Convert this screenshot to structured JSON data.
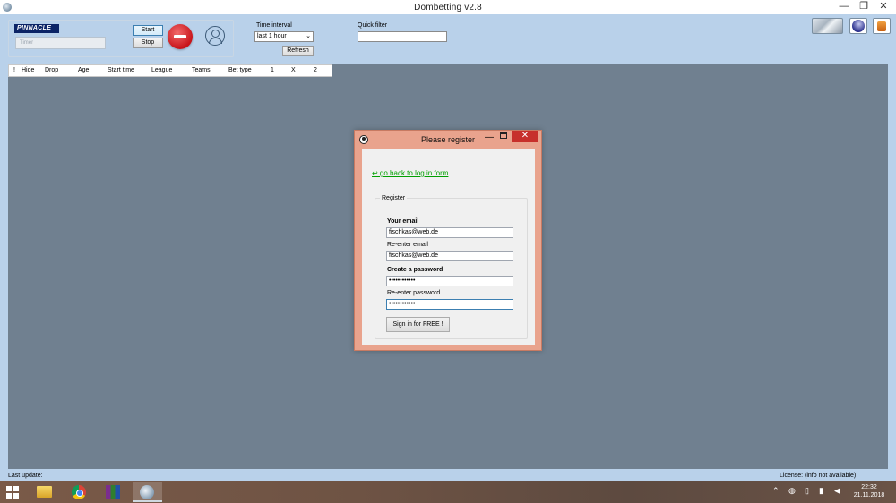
{
  "window": {
    "title": "Dombetting   v2.8",
    "min": "—",
    "max": "❐",
    "close": "✕"
  },
  "toolbar": {
    "logo": "PINNACLE",
    "timer_placeholder": "Timer",
    "start": "Start",
    "stop": "Stop",
    "time_interval_label": "Time interval",
    "time_interval_value": "last 1 hour",
    "refresh": "Refresh",
    "quick_filter_label": "Quick filter",
    "quick_filter_value": ""
  },
  "grid": {
    "columns": [
      "!",
      "Hide",
      "Drop",
      "Age",
      "Start time",
      "League",
      "Teams",
      "Bet type",
      "1",
      "X",
      "2"
    ]
  },
  "dialog": {
    "title": "Please register",
    "back_link": "↩ go back to log in form",
    "group": "Register",
    "email_label": "Your email",
    "email_value": "fischkas@web.de",
    "reemail_label": "Re-enter email",
    "reemail_value": "fischkas@web.de",
    "password_label": "Create a password",
    "password_value": "••••••••••••",
    "repassword_label": "Re-enter password",
    "repassword_value": "••••••••••••",
    "signin": "Sign in for FREE !"
  },
  "status": {
    "last_update": "Last update:",
    "license": "License: (info not available)"
  },
  "taskbar": {
    "time": "22:32",
    "date": "21.11.2018"
  }
}
